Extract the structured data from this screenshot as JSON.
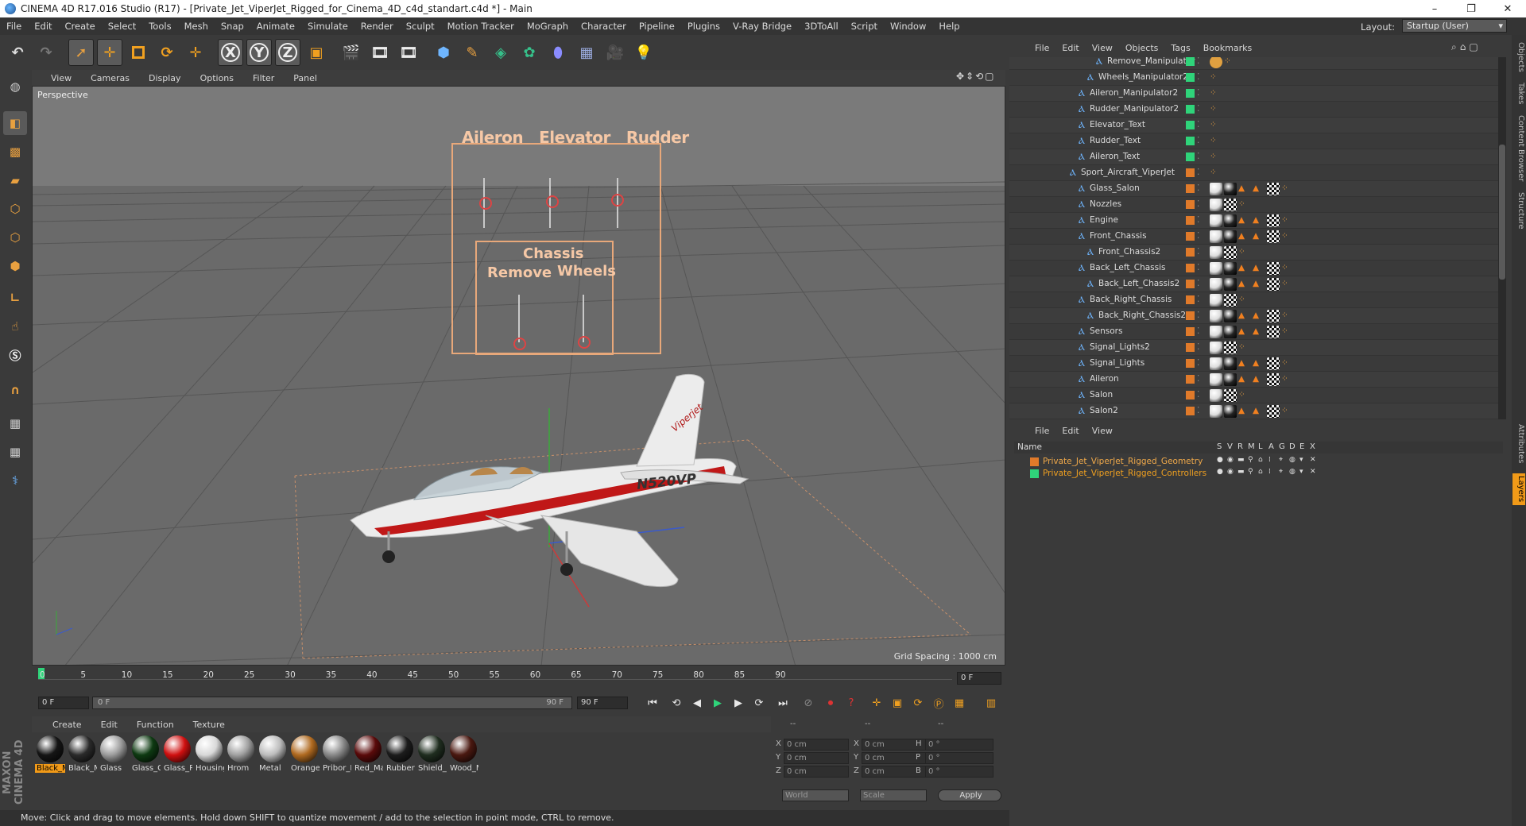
{
  "window": {
    "title": "CINEMA 4D R17.016 Studio (R17) - [Private_Jet_ViperJet_Rigged_for_Cinema_4D_c4d_standart.c4d *] - Main",
    "minimize": "–",
    "maximize": "❐",
    "close": "✕"
  },
  "menubar": [
    "File",
    "Edit",
    "Create",
    "Select",
    "Tools",
    "Mesh",
    "Snap",
    "Animate",
    "Simulate",
    "Render",
    "Sculpt",
    "Motion Tracker",
    "MoGraph",
    "Character",
    "Pipeline",
    "Plugins",
    "V-Ray Bridge",
    "3DToAll",
    "Script",
    "Window",
    "Help"
  ],
  "layout": {
    "label": "Layout:",
    "value": "Startup (User)"
  },
  "toolbar": {
    "axis_x": "X",
    "axis_y": "Y",
    "axis_z": "Z"
  },
  "viewport": {
    "menu": [
      "View",
      "Cameras",
      "Display",
      "Options",
      "Filter",
      "Panel"
    ],
    "label": "Perspective",
    "grid_spacing": "Grid Spacing : 1000 cm",
    "hud": {
      "top_labels": [
        "Aileron",
        "Elevator",
        "Rudder"
      ],
      "chassis": "Chassis",
      "remove": "Remove",
      "wheels": "Wheels"
    },
    "plane_reg": "N520VP",
    "plane_script": "Viperjet"
  },
  "timeline": {
    "ticks": [
      "0",
      "5",
      "10",
      "15",
      "20",
      "25",
      "30",
      "35",
      "40",
      "45",
      "50",
      "55",
      "60",
      "65",
      "70",
      "75",
      "80",
      "85",
      "90"
    ],
    "current_frame": "0 F",
    "start_field": "0 F",
    "range_start": "0 F",
    "range_end": "90 F",
    "end_field": "90 F"
  },
  "material_manager": {
    "menu": [
      "Create",
      "Edit",
      "Function",
      "Texture"
    ],
    "materials": [
      {
        "name": "Black_M",
        "color": "#151515",
        "selected": true
      },
      {
        "name": "Black_M",
        "color": "#2a2a2a",
        "selected": false
      },
      {
        "name": "Glass",
        "color": "#9c9c9c",
        "selected": false
      },
      {
        "name": "Glass_G",
        "color": "#0e3a12",
        "selected": false
      },
      {
        "name": "Glass_R",
        "color": "#d01010",
        "selected": false
      },
      {
        "name": "Housing",
        "color": "#d8d8d8",
        "selected": false
      },
      {
        "name": "Hrom",
        "color": "#a0a0a0",
        "selected": false
      },
      {
        "name": "Metal",
        "color": "#bdbdbd",
        "selected": false
      },
      {
        "name": "Orange",
        "color": "#b06a20",
        "selected": false
      },
      {
        "name": "Pribor_M",
        "color": "#888888",
        "selected": false
      },
      {
        "name": "Red_Ma",
        "color": "#5a0a0a",
        "selected": false
      },
      {
        "name": "Rubber",
        "color": "#1c1c1c",
        "selected": false
      },
      {
        "name": "Shield_M",
        "color": "#1f2d1f",
        "selected": false
      },
      {
        "name": "Wood_M",
        "color": "#4a1810",
        "selected": false
      }
    ]
  },
  "coordinates": {
    "header": [
      "--",
      "--",
      "--"
    ],
    "rows": [
      {
        "axis": "X",
        "pos": "0 cm",
        "size_axis": "X",
        "size": "0 cm",
        "rot_axis": "H",
        "rot": "0 °"
      },
      {
        "axis": "Y",
        "pos": "0 cm",
        "size_axis": "Y",
        "size": "0 cm",
        "rot_axis": "P",
        "rot": "0 °"
      },
      {
        "axis": "Z",
        "pos": "0 cm",
        "size_axis": "Z",
        "size": "0 cm",
        "rot_axis": "B",
        "rot": "0 °"
      }
    ],
    "world": "World",
    "scale": "Scale",
    "apply": "Apply"
  },
  "status": "Move: Click and drag to move elements. Hold down SHIFT to quantize movement / add to the selection in point mode, CTRL to remove.",
  "object_manager": {
    "menu": [
      "File",
      "Edit",
      "View",
      "Objects",
      "Tags",
      "Bookmarks"
    ],
    "objects": [
      {
        "name": "Remove_Manipulator",
        "indent": 3,
        "color": "green"
      },
      {
        "name": "Wheels_Manipulator2",
        "indent": 2,
        "color": "green"
      },
      {
        "name": "Aileron_Manipulator2",
        "indent": 1,
        "color": "green"
      },
      {
        "name": "Rudder_Manipulator2",
        "indent": 1,
        "color": "green"
      },
      {
        "name": "Elevator_Text",
        "indent": 1,
        "color": "green"
      },
      {
        "name": "Rudder_Text",
        "indent": 1,
        "color": "green"
      },
      {
        "name": "Aileron_Text",
        "indent": 1,
        "color": "green"
      },
      {
        "name": "Sport_Aircraft_ViperJet",
        "indent": 0,
        "color": "orange"
      },
      {
        "name": "Glass_Salon",
        "indent": 1,
        "color": "orange"
      },
      {
        "name": "Nozzles",
        "indent": 1,
        "color": "orange"
      },
      {
        "name": "Engine",
        "indent": 1,
        "color": "orange"
      },
      {
        "name": "Front_Chassis",
        "indent": 1,
        "color": "orange"
      },
      {
        "name": "Front_Chassis2",
        "indent": 2,
        "color": "orange"
      },
      {
        "name": "Back_Left_Chassis",
        "indent": 1,
        "color": "orange"
      },
      {
        "name": "Back_Left_Chassis2",
        "indent": 2,
        "color": "orange"
      },
      {
        "name": "Back_Right_Chassis",
        "indent": 1,
        "color": "orange"
      },
      {
        "name": "Back_Right_Chassis2",
        "indent": 2,
        "color": "orange"
      },
      {
        "name": "Sensors",
        "indent": 1,
        "color": "orange"
      },
      {
        "name": "Signal_Lights2",
        "indent": 1,
        "color": "orange"
      },
      {
        "name": "Signal_Lights",
        "indent": 1,
        "color": "orange"
      },
      {
        "name": "Aileron",
        "indent": 1,
        "color": "orange"
      },
      {
        "name": "Salon",
        "indent": 1,
        "color": "orange"
      },
      {
        "name": "Salon2",
        "indent": 1,
        "color": "orange"
      }
    ]
  },
  "layer_manager": {
    "menu": [
      "File",
      "Edit",
      "View"
    ],
    "header": {
      "name": "Name",
      "cols": [
        "S",
        "V",
        "R",
        "M",
        "L",
        "A",
        "G",
        "D",
        "E",
        "X"
      ]
    },
    "layers": [
      {
        "name": "Private_Jet_ViperJet_Rigged_Geometry",
        "color": "#e07a2a",
        "text_color": "#f0a94a"
      },
      {
        "name": "Private_Jet_ViperJet_Rigged_Controllers",
        "color": "#2fd47a",
        "text_color": "#f0a020"
      }
    ]
  },
  "side_tabs": [
    "Objects",
    "Takes",
    "Content Browser",
    "Structure",
    "Attributes",
    "Layers"
  ],
  "maxon_logo": "MAXON CINEMA 4D"
}
